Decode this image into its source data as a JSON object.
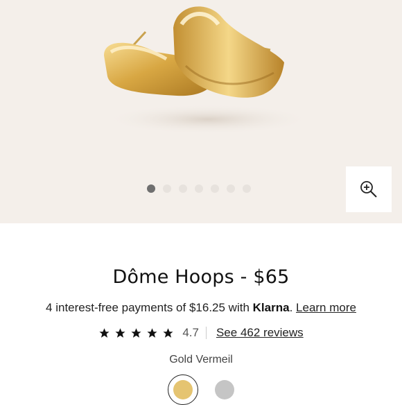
{
  "product": {
    "title": "Dôme Hoops - $65",
    "payments_prefix": "4 interest-free payments of $16.25 with ",
    "payments_brand": "Klarna",
    "payments_suffix": ".",
    "learn_more": "Learn more",
    "rating_value": "4.7",
    "reviews_link": "See 462 reviews",
    "variant_label": "Gold Vermeil"
  },
  "gallery": {
    "image_count": 7,
    "active_index": 0,
    "zoom_icon": "zoom-in-icon",
    "background": "#f4efea"
  },
  "rating": {
    "stars": 5,
    "star_icon": "star-icon"
  },
  "swatches": [
    {
      "name": "gold",
      "color": "#e5c471",
      "selected": true
    },
    {
      "name": "silver",
      "color": "#c5c5c5",
      "selected": false
    }
  ],
  "colors": {
    "gold": "#d9ac4a",
    "dot_active": "#6f6f6f",
    "dot_inactive": "#e7e2dd"
  }
}
